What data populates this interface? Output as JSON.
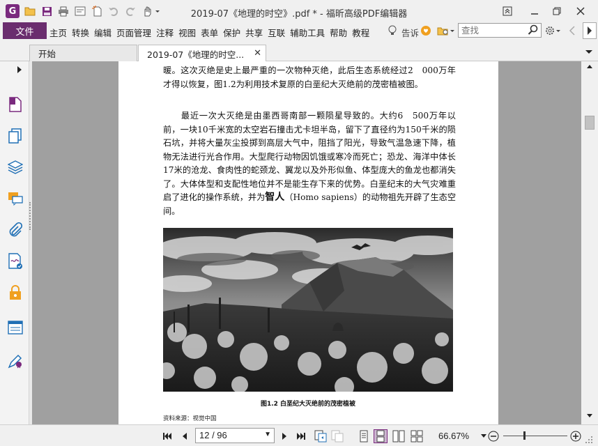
{
  "titlebar": {
    "title": "2019-07《地理的时空》.pdf * - 福昕高级PDF编辑器",
    "logo_letter": "G"
  },
  "menubar": {
    "file_label": "文件",
    "items": [
      "主页",
      "转换",
      "编辑",
      "页面管理",
      "注释",
      "视图",
      "表单",
      "保护",
      "共享",
      "互联",
      "辅助工具",
      "帮助",
      "教程"
    ],
    "tell_me": "告诉",
    "search_placeholder": "查找"
  },
  "tabs": [
    {
      "label": "开始"
    },
    {
      "label": "2019-07《地理的时空...",
      "closable": true
    }
  ],
  "document": {
    "para1": "暖。这次灭绝是史上最严重的一次物种灭绝，此后生态系统经过2　000万年才得以恢复，图1.2为利用技术复原的白垩纪大灭绝前的茂密植被图。",
    "para2_a": "　　最近一次大灭绝是由墨西哥南部一颗陨星导致的。大约6　500万年以前，一块10千米宽的太空岩石撞击尤卡坦半岛，留下了直径约为150千米的陨石坑，并将大量灰尘投掷到高层大气中，阻挡了阳光，导致气温急速下降，植物无法进行光合作用。大型爬行动物因饥饿或寒冷而死亡；恐龙、海洋中体长17米的沧龙、食肉性的蛇颈龙、翼龙以及外形似鱼、体型庞大的鱼龙也都消失了。大体体型和支配性地位并不是能生存下来的优势。白垩纪末的大气灾难重启了进化的操作系统，并为",
    "para2_bold": "智人",
    "para2_b": "（Homo sapiens）的动物祖先开辟了生态空间。",
    "caption": "图1.2 白垩纪大灭绝前的茂密植被",
    "source": "资料来源：视觉中国"
  },
  "statusbar": {
    "page_display": "12 / 96",
    "zoom": "66.67%"
  },
  "colors": {
    "accent": "#6a2d6e",
    "doc_background": "#a0a0a0"
  }
}
